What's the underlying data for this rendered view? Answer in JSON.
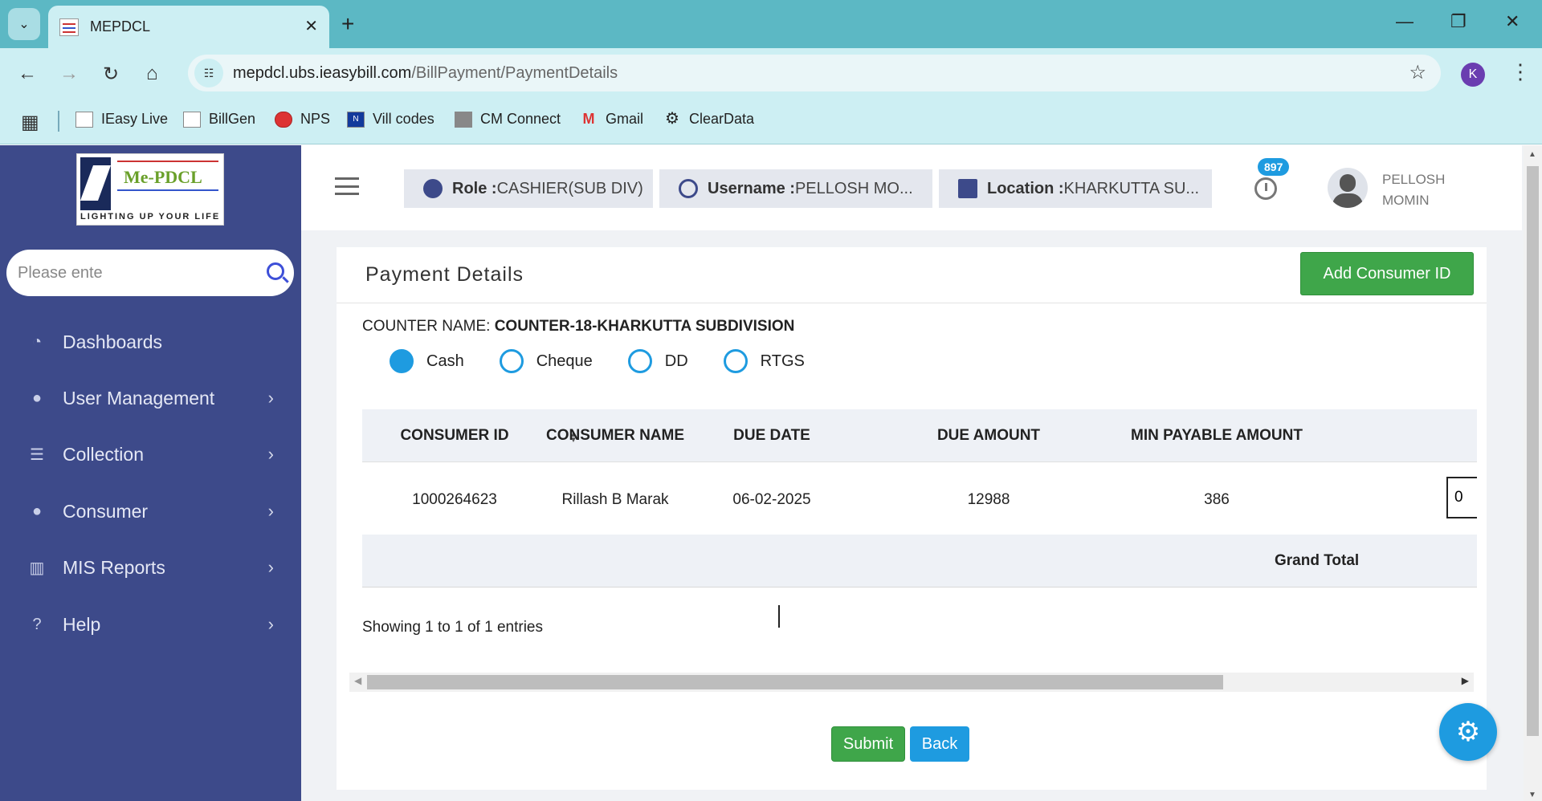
{
  "browser": {
    "tab_title": "MEPDCL",
    "tab_close": "✕",
    "new_tab": "+",
    "url_host": "mepdcl.ubs.ieasybill.com",
    "url_path": "/BillPayment/PaymentDetails",
    "profile_initial": "K",
    "bookmarks": [
      "IEasy Live",
      "BillGen",
      "NPS",
      "Vill codes",
      "CM Connect",
      "Gmail",
      "ClearData"
    ]
  },
  "sidebar": {
    "logo_text": "Me-PDCL",
    "logo_tagline": "LIGHTING UP YOUR LIFE",
    "search_placeholder": "Please ente",
    "items": [
      {
        "label": "Dashboards",
        "icon": "dashboard-icon"
      },
      {
        "label": "User Management",
        "icon": "user-icon"
      },
      {
        "label": "Collection",
        "icon": "list-icon"
      },
      {
        "label": "Consumer",
        "icon": "user-icon"
      },
      {
        "label": "MIS Reports",
        "icon": "bar-chart-icon"
      },
      {
        "label": "Help",
        "icon": "help-icon"
      }
    ]
  },
  "header": {
    "role_label": "Role :",
    "role_value": "CASHIER(SUB DIV)",
    "username_label": "Username :",
    "username_value": "PELLOSH MO...",
    "location_label": "Location :",
    "location_value": "KHARKUTTA SU...",
    "notification_count": "897",
    "user_name": "PELLOSH MOMIN"
  },
  "card": {
    "title": "Payment Details",
    "add_button": "Add Consumer ID",
    "counter_label": "COUNTER NAME:",
    "counter_value": "COUNTER-18-KHARKUTTA SUBDIVISION",
    "payment_modes": [
      {
        "label": "Cash",
        "selected": true
      },
      {
        "label": "Cheque",
        "selected": false
      },
      {
        "label": "DD",
        "selected": false
      },
      {
        "label": "RTGS",
        "selected": false
      }
    ]
  },
  "table": {
    "columns": [
      "CONSUMER ID",
      "CONSUMER NAME",
      "DUE DATE",
      "DUE AMOUNT",
      "MIN PAYABLE AMOUNT"
    ],
    "rows": [
      {
        "consumer_id": "1000264623",
        "consumer_name": "Rillash B Marak",
        "due_date": "06-02-2025",
        "due_amount": "12988",
        "min_payable": "386",
        "pay_amount": "0"
      }
    ],
    "grand_total_label": "Grand Total",
    "showing": "Showing 1 to 1 of 1 entries"
  },
  "actions": {
    "submit": "Submit",
    "back": "Back"
  }
}
